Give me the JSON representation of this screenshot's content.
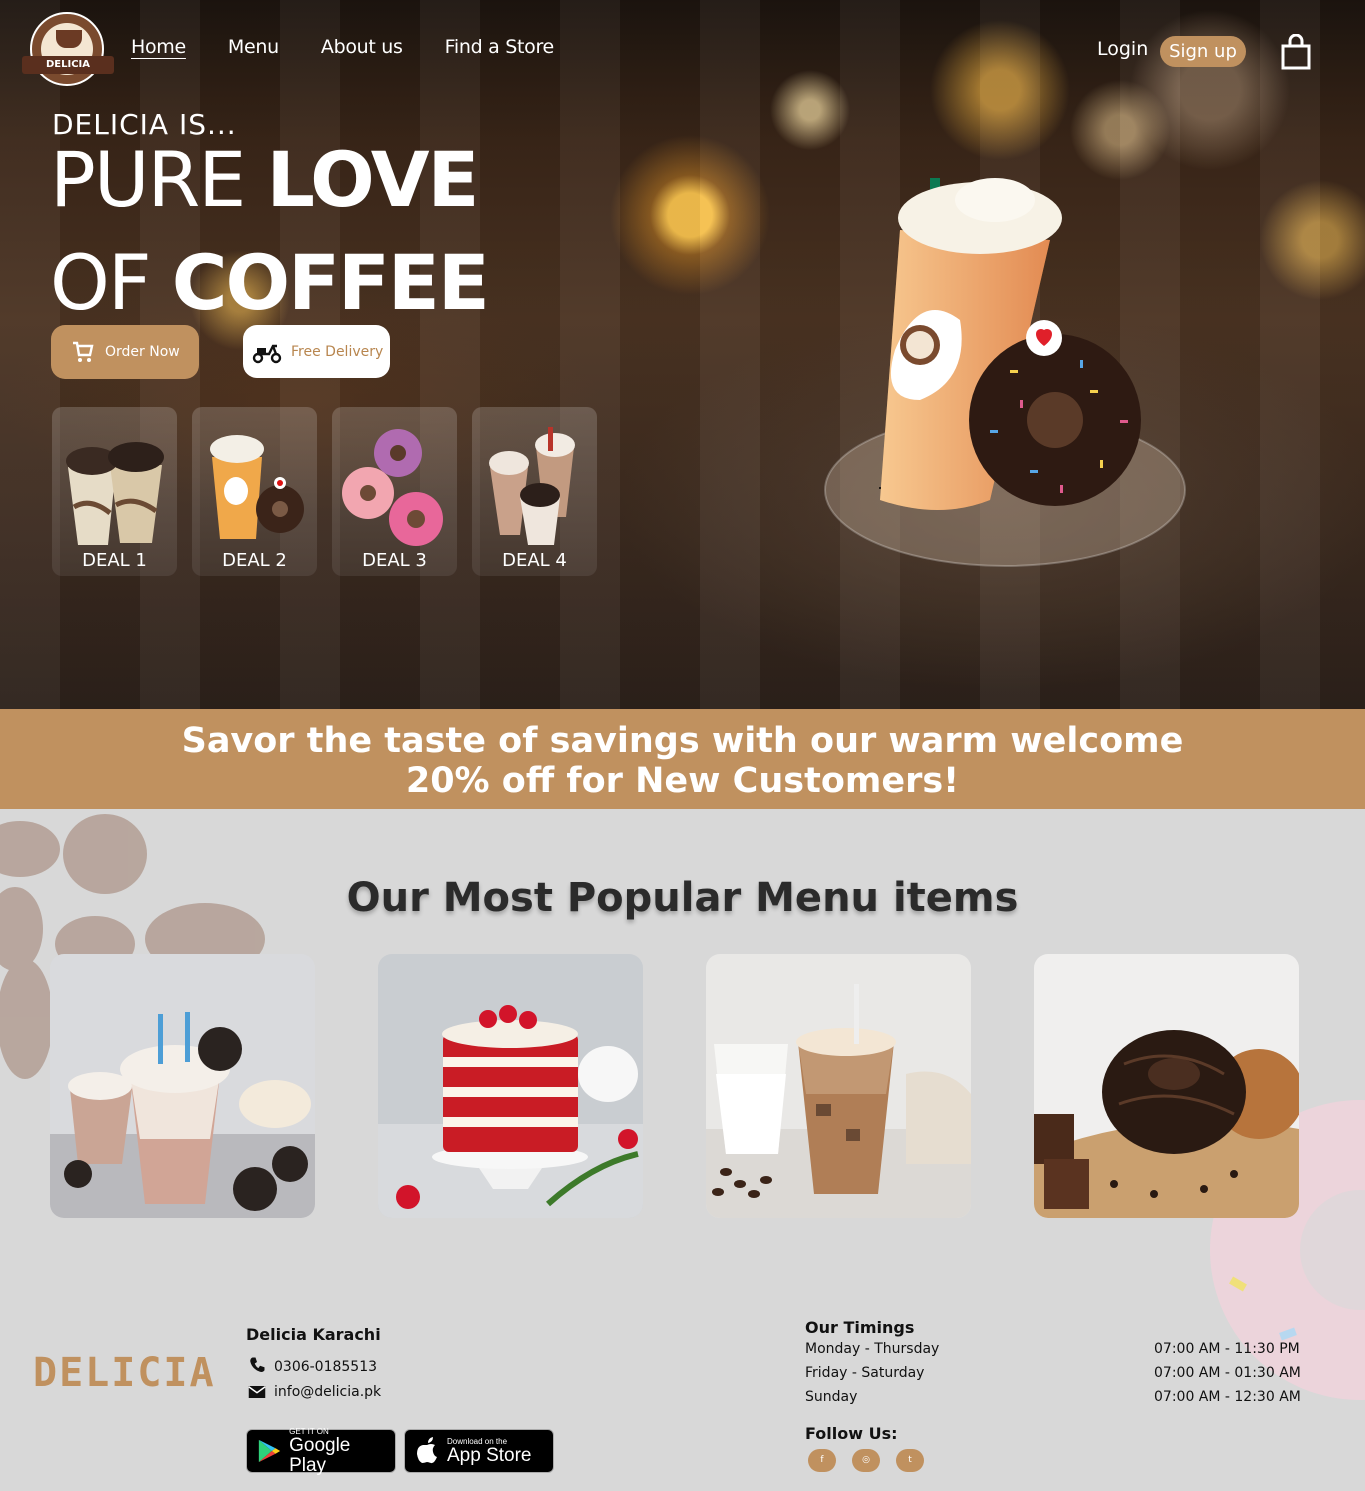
{
  "brand": {
    "logo_text": "DELICIA",
    "footer_logo": "DELICIA",
    "accent": "#c0915f"
  },
  "nav": {
    "items": [
      {
        "label": "Home",
        "active": true
      },
      {
        "label": "Menu",
        "active": false
      },
      {
        "label": "About us",
        "active": false
      },
      {
        "label": "Find a Store",
        "active": false
      }
    ],
    "login": "Login",
    "signup": "Sign up",
    "cart_icon": "shopping-bag-icon"
  },
  "hero": {
    "tagline": "DELICIA IS...",
    "line1_light": "PURE ",
    "line1_bold": "LOVE",
    "line2_light": "OF ",
    "line2_bold": "COFFEE",
    "order_button": "Order Now",
    "delivery_button": "Free Delivery",
    "deals": [
      "DEAL 1",
      "DEAL 2",
      "DEAL 3",
      "DEAL 4"
    ]
  },
  "promo": {
    "line1": "Savor the taste of savings with our warm welcome",
    "line2": "20% off for New Customers!"
  },
  "popular": {
    "title": "Our Most Popular Menu items"
  },
  "footer": {
    "location_title": "Delicia Karachi",
    "phone": "0306-0185513",
    "email": "info@delicia.pk",
    "google_play_small": "GET IT ON",
    "google_play_big": "Google Play",
    "app_store_small": "Download on the",
    "app_store_big": "App Store",
    "timings_title": "Our Timings",
    "timings": [
      {
        "days": "Monday - Thursday",
        "hours": "07:00 AM - 11:30 PM"
      },
      {
        "days": "Friday - Saturday",
        "hours": "07:00 AM - 01:30 AM"
      },
      {
        "days": "Sunday",
        "hours": "07:00 AM - 12:30 AM"
      }
    ],
    "follow_title": "Follow Us:",
    "social": [
      "f",
      "◎",
      "t"
    ]
  }
}
